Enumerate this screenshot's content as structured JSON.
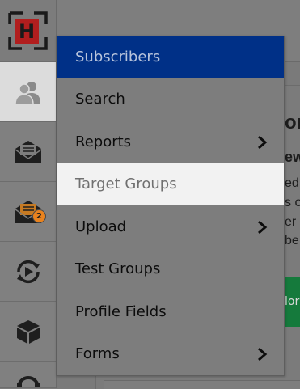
{
  "logo": {
    "letter": "H",
    "color": "#d0021b"
  },
  "rail": {
    "items": [
      {
        "name": "subscribers",
        "icon": "users-icon",
        "active": true
      },
      {
        "name": "mailings",
        "icon": "envelope-open-icon",
        "active": false
      },
      {
        "name": "drafts",
        "icon": "envelope-document-icon",
        "active": false,
        "badge": "2"
      },
      {
        "name": "automation",
        "icon": "cycle-play-icon",
        "active": false
      },
      {
        "name": "content",
        "icon": "cube-icon",
        "active": false
      },
      {
        "name": "support",
        "icon": "headset-icon",
        "active": false
      }
    ]
  },
  "menu": {
    "header": "Subscribers",
    "items": [
      {
        "label": "Search",
        "has_submenu": false,
        "highlighted": false
      },
      {
        "label": "Reports",
        "has_submenu": true,
        "highlighted": false
      },
      {
        "label": "Target Groups",
        "has_submenu": false,
        "highlighted": true
      },
      {
        "label": "Upload",
        "has_submenu": true,
        "highlighted": false
      },
      {
        "label": "Test Groups",
        "has_submenu": false,
        "highlighted": false
      },
      {
        "label": "Profile Fields",
        "has_submenu": false,
        "highlighted": false
      },
      {
        "label": "Forms",
        "has_submenu": true,
        "highlighted": false
      }
    ]
  },
  "background": {
    "heading_fragment": "or",
    "subheading_fragment": "ew",
    "lines": [
      "ed",
      "s o",
      "er",
      "be"
    ],
    "button_fragment": "lor"
  },
  "colors": {
    "menu_header_bg": "#003087",
    "highlight_bg": "#f2f2f2",
    "rail_active_bg": "#dcdcdc",
    "badge_bg": "#e8821e",
    "green_button": "#157a3c"
  }
}
